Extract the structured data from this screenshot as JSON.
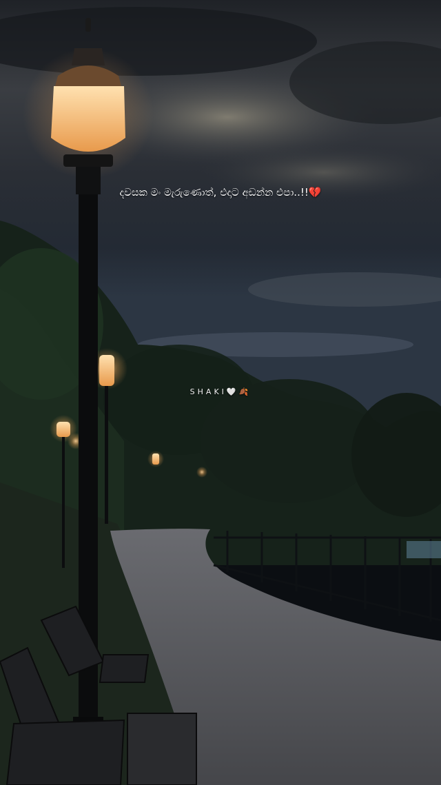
{
  "caption": "දවසක මං මැරුණොත්, එදාට අඩන්න එපා..!!💔",
  "signature": "SHAKI🤍🍂",
  "colors": {
    "sky": "#2b3036",
    "lamp_glow": "#f6b46a",
    "foliage": "#1a2a1c",
    "path": "#56575b"
  }
}
